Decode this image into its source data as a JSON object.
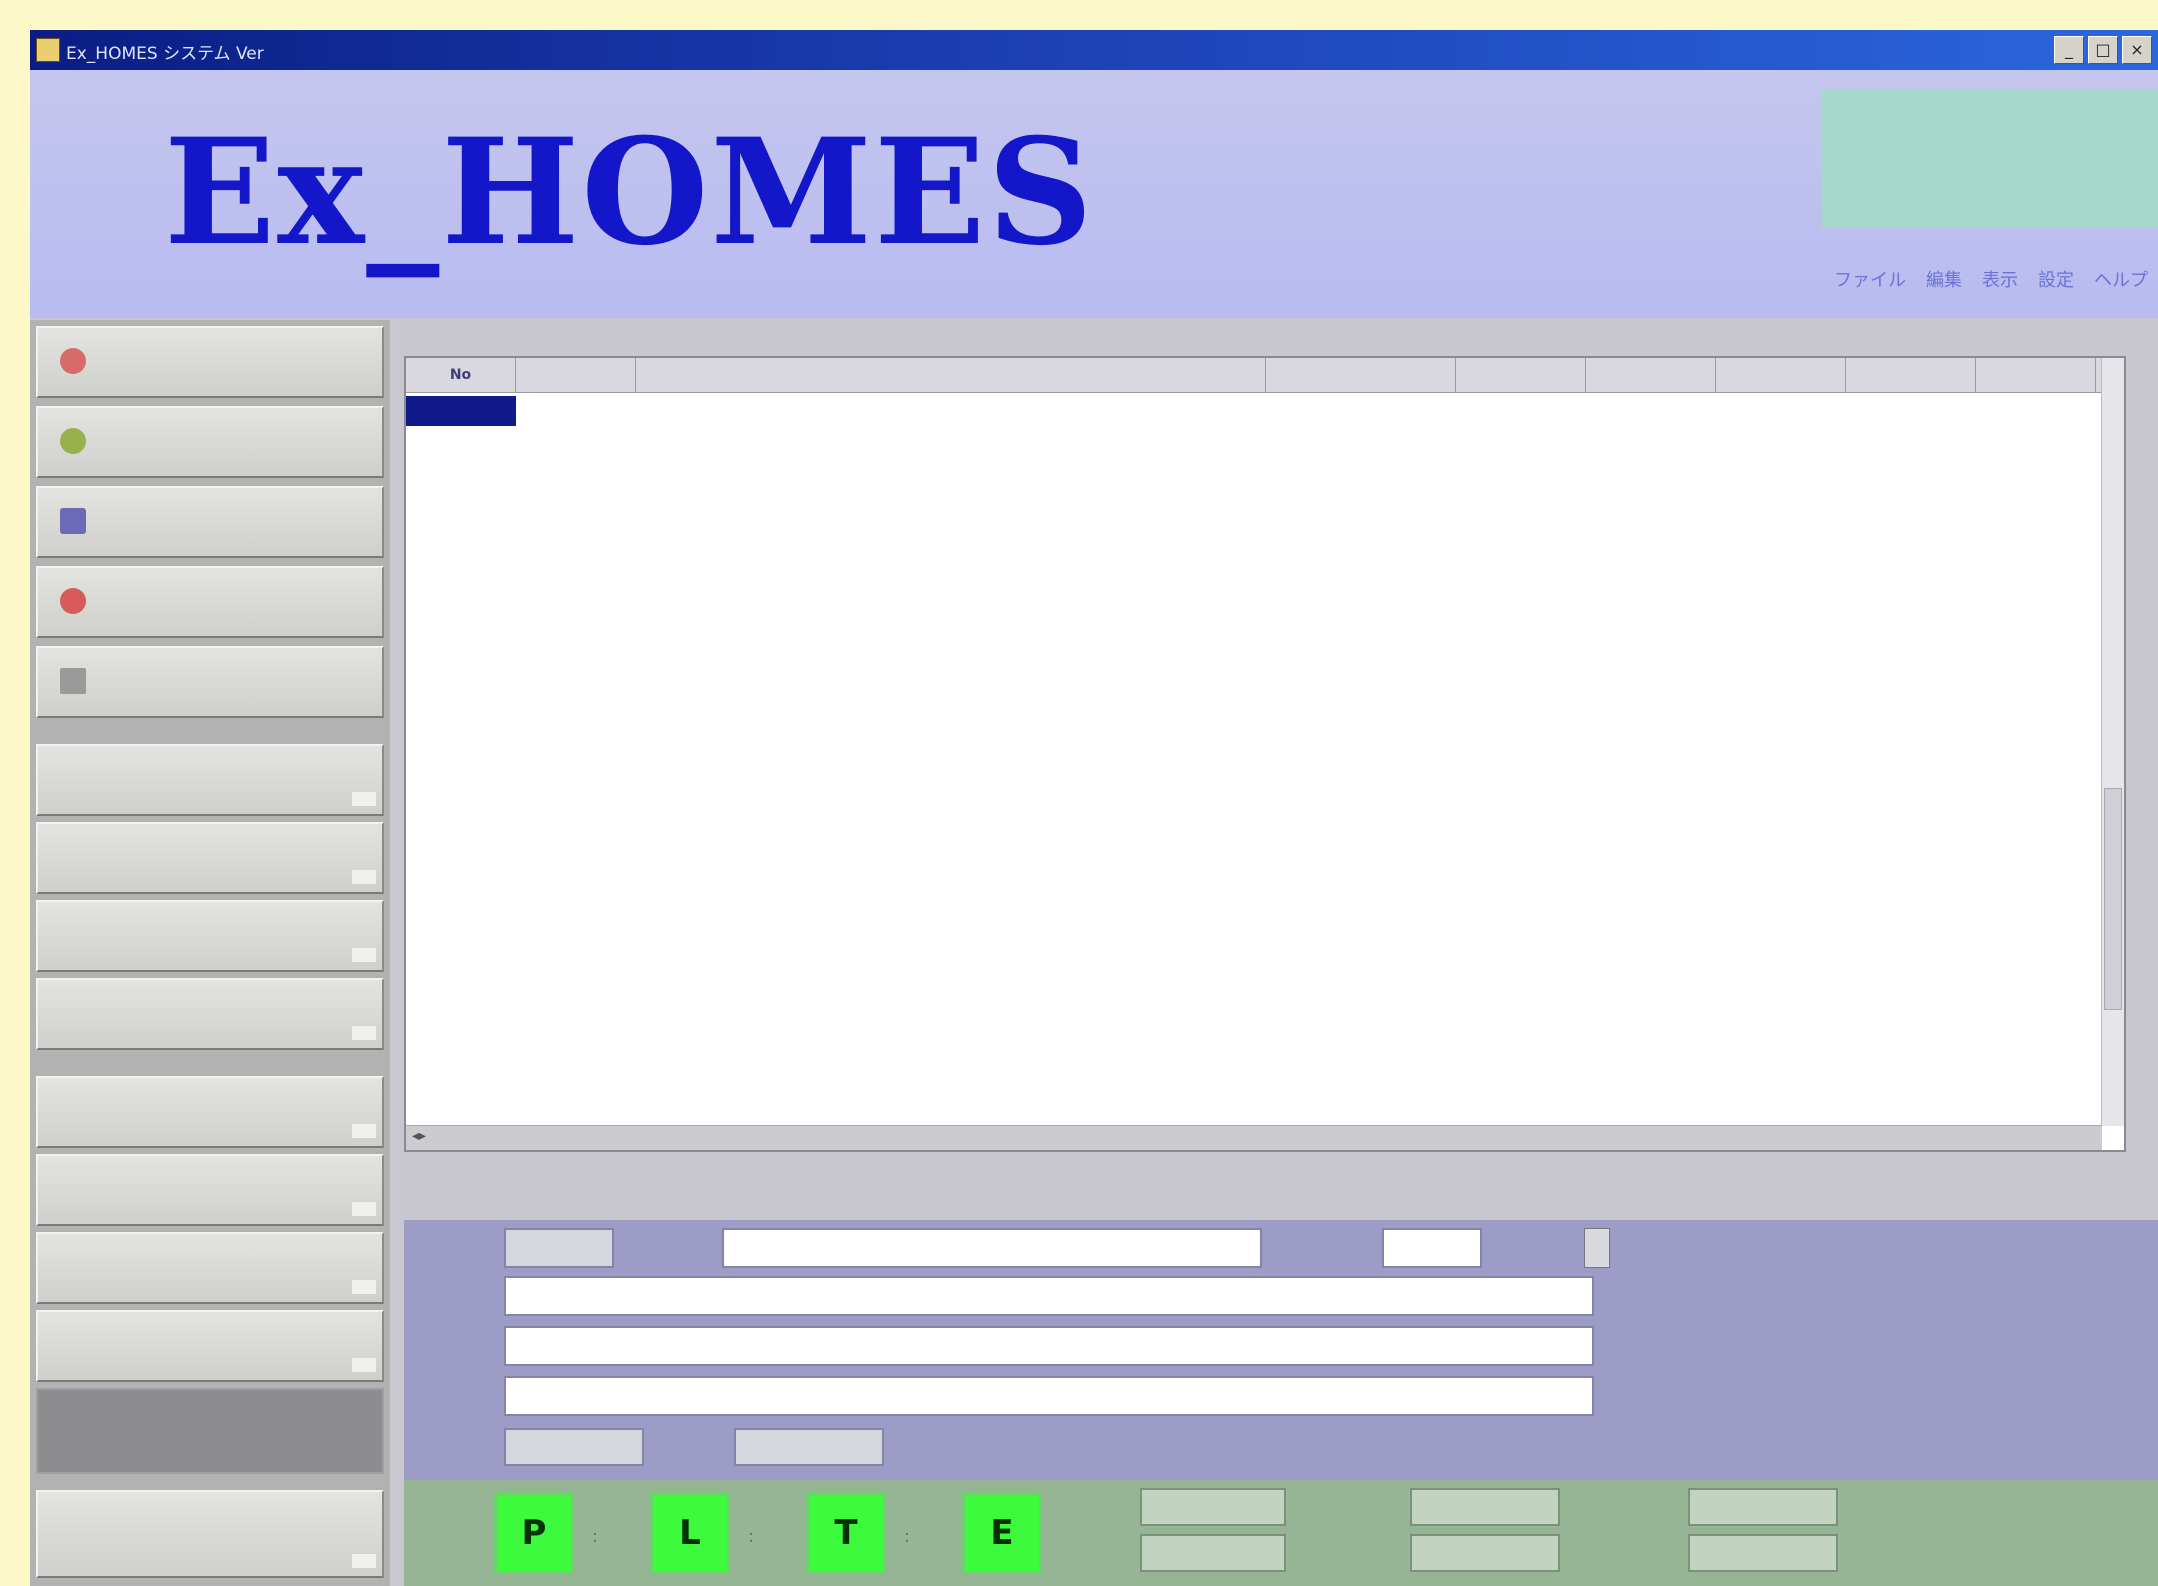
{
  "window": {
    "title": "Ex_HOMES システム Ver",
    "controls": [
      "_",
      "□",
      "×"
    ]
  },
  "header": {
    "logo": "Ex_HOMES",
    "info_lines": [
      "",
      "",
      "",
      ""
    ],
    "menu": [
      "ファイル",
      "編集",
      "表示",
      "設定",
      "ヘルプ"
    ]
  },
  "sidebar": {
    "buttons": [
      {
        "label": "",
        "icon": "house-icon",
        "color": "#d86a6a"
      },
      {
        "label": "",
        "icon": "plant-icon",
        "color": "#9ab04a"
      },
      {
        "label": "",
        "icon": "document-icon",
        "color": "#6a6ab8"
      },
      {
        "label": "",
        "icon": "stop-icon",
        "color": "#d85a5a"
      },
      {
        "label": "",
        "icon": "door-icon",
        "color": "#8a8a8a"
      }
    ]
  },
  "grid": {
    "caption": "",
    "columns": [
      "No",
      "",
      "",
      "",
      "",
      "",
      "",
      "",
      ""
    ],
    "rows": [
      [
        "",
        "",
        "",
        "",
        "",
        "",
        "",
        "",
        ""
      ],
      [
        "",
        "",
        "",
        "",
        "",
        "",
        "",
        "",
        ""
      ]
    ]
  },
  "detail": {
    "caption": "",
    "row1": {
      "label": "",
      "code": "",
      "name_label": "",
      "name_value": "",
      "date_label": "",
      "date_value": ""
    },
    "line_labels": [
      "",
      "",
      ""
    ],
    "bottom": {
      "label": "",
      "field1": "",
      "field2_label": "",
      "field2": ""
    }
  },
  "actions": {
    "label": "",
    "buttons": [
      {
        "top": "",
        "glyph": "P"
      },
      {
        "top": "",
        "glyph": "L"
      },
      {
        "top": "",
        "glyph": "T"
      },
      {
        "top": "",
        "glyph": "E"
      }
    ],
    "stats": [
      {
        "label": "",
        "value": ""
      },
      {
        "label": "",
        "value": ""
      },
      {
        "label": "",
        "value": ""
      },
      {
        "label": "",
        "value": ""
      },
      {
        "label": "",
        "value": ""
      },
      {
        "label": "",
        "value": ""
      }
    ]
  },
  "colors": {
    "accent": "#1316c9",
    "selection": "#101a8a",
    "action_green": "#3dfa3d"
  }
}
